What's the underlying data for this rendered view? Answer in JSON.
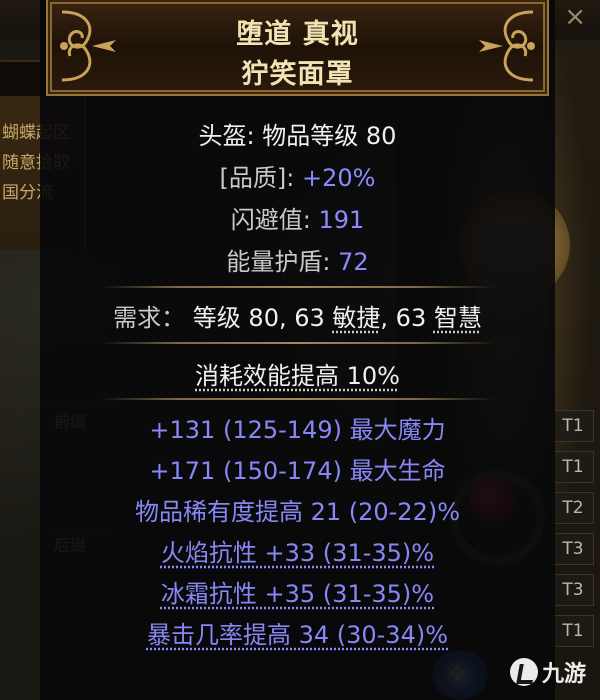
{
  "background": {
    "left_menu_tab": "犬",
    "left_menu_items": [
      "蝴蝶起区",
      "随意拾取",
      "国分流"
    ],
    "slot_labels": [
      "前缀",
      "后缀"
    ],
    "tiers": [
      "T1",
      "T1",
      "T2",
      "T3",
      "T3",
      "T1"
    ],
    "close_glyph": "×"
  },
  "item": {
    "name_line1": "堕道 真视",
    "name_line2": "狞笑面罩",
    "type_label": "头盔: 物品等级 80",
    "quality_label": "[品质]: ",
    "quality_value": "+20%",
    "evasion_label": "闪避值: ",
    "evasion_value": "191",
    "energy_label": "能量护盾: ",
    "energy_value": "72",
    "requirements": {
      "label": "需求：",
      "level_text": "等级 80, ",
      "dex_value": "63 ",
      "dex_label": "敏捷",
      "sep": ", ",
      "int_value": "63 ",
      "int_label": "智慧"
    },
    "implicit": "消耗效能提高 10%",
    "mods": [
      "+131 (125-149) 最大魔力",
      "+171 (150-174) 最大生命",
      "物品稀有度提高 21 (20-22)%",
      "火焰抗性 +33 (31-35)%",
      "冰霜抗性 +35 (31-35)%",
      "暴击几率提高 34 (30-34)%"
    ]
  },
  "watermark": "九游",
  "colors": {
    "title": "#f2e3b4",
    "magic_mod": "#8787f5",
    "header_border": "#9a7436"
  }
}
